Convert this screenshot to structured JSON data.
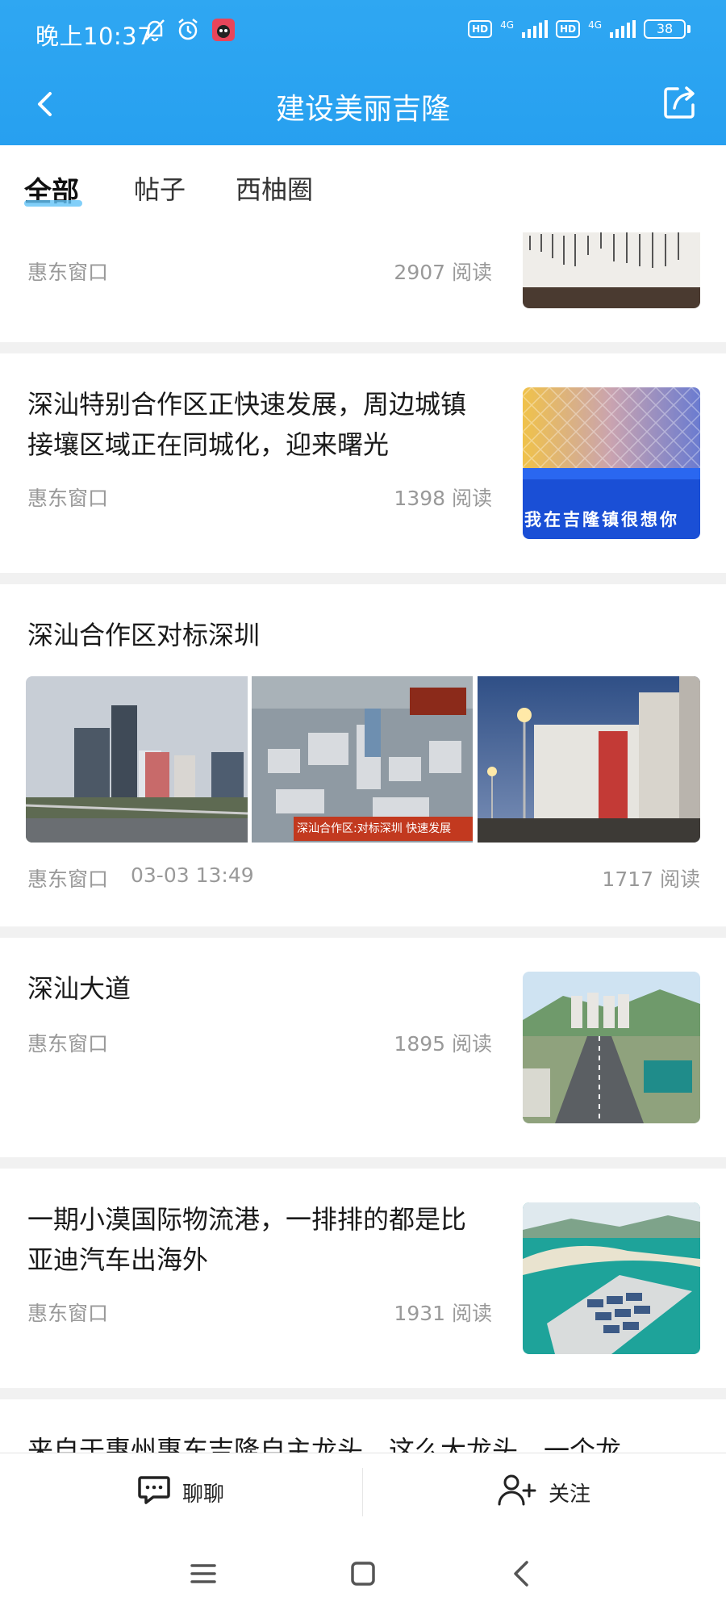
{
  "status_bar": {
    "time": "晚上10:37",
    "network1": "4G",
    "network2": "4G",
    "hd": "HD",
    "battery": "38"
  },
  "titlebar": {
    "title": "建设美丽吉隆"
  },
  "tabs": [
    {
      "label": "全部"
    },
    {
      "label": "帖子"
    },
    {
      "label": "西柚圈"
    }
  ],
  "feed": [
    {
      "author": "惠东窗口",
      "reads": "2907 阅读"
    },
    {
      "headline": "深汕特别合作区正快速发展，周边城镇接壤区域正在同城化，迎来曙光",
      "author": "惠东窗口",
      "reads": "1398 阅读",
      "image_caption": "我在吉隆镇很想你"
    },
    {
      "headline": "深汕合作区对标深圳",
      "author": "惠东窗口",
      "date": "03-03 13:49",
      "reads": "1717 阅读",
      "image_caption": "深汕合作区:对标深圳 快速发展"
    },
    {
      "headline": "深汕大道",
      "author": "惠东窗口",
      "reads": "1895 阅读"
    },
    {
      "headline": "一期小漠国际物流港，一排排的都是比亚迪汽车出海外",
      "author": "惠东窗口",
      "reads": "1931 阅读"
    },
    {
      "headline": "来自于惠州惠东吉隆自主龙头，这么大龙头，一个龙"
    }
  ],
  "bottom_bar": {
    "chat_label": "聊聊",
    "follow_label": "关注"
  },
  "colors": {
    "header": "#2fa7f2",
    "tab_underline": "#62c3f7",
    "meta_gray": "#999999"
  }
}
